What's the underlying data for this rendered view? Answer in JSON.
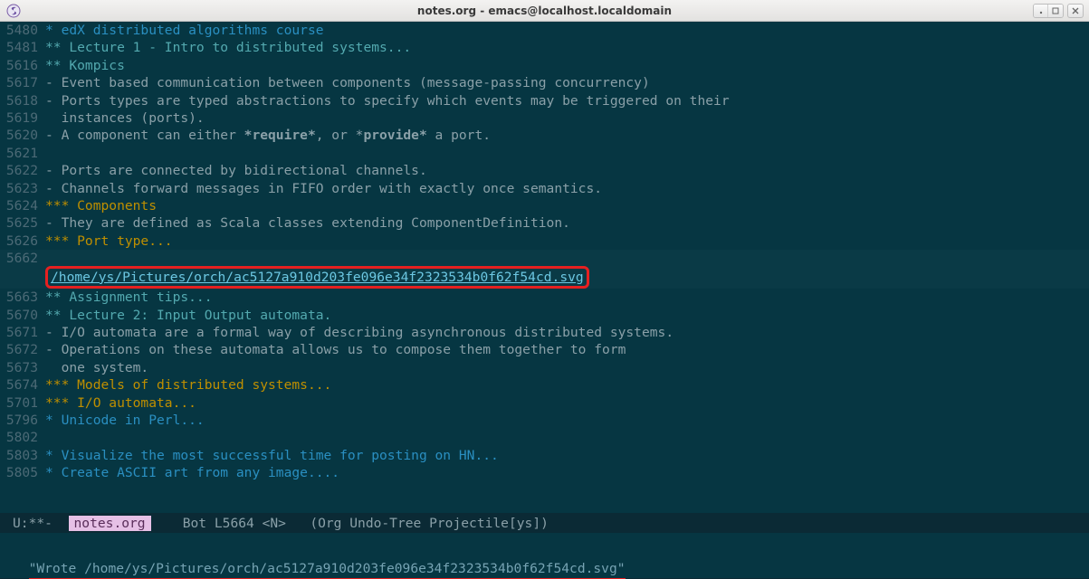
{
  "window": {
    "title": "notes.org - emacs@localhost.localdomain"
  },
  "buffer": {
    "lines": [
      {
        "n": "5480",
        "cls": "h1",
        "text": "* edX distributed algorithms course"
      },
      {
        "n": "5481",
        "cls": "h2",
        "text": "** Lecture 1 - Intro to distributed systems..."
      },
      {
        "n": "5616",
        "cls": "h2",
        "text": "** Kompics"
      },
      {
        "n": "5617",
        "cls": "txt",
        "text": "- Event based communication between components (message-passing concurrency)"
      },
      {
        "n": "5618",
        "cls": "txt",
        "text": "- Ports types are typed abstractions to specify which events may be triggered on their"
      },
      {
        "n": "5619",
        "cls": "txt",
        "text": "  instances (ports)."
      },
      {
        "n": "5620",
        "cls": "txt",
        "text": "- A component can either *require*, or *provide* a port.",
        "bold_runs": [
          [
            25,
            34
          ],
          [
            40,
            49
          ]
        ]
      },
      {
        "n": "5621",
        "cls": "txt",
        "text": ""
      },
      {
        "n": "5622",
        "cls": "txt",
        "text": "- Ports are connected by bidirectional channels."
      },
      {
        "n": "5623",
        "cls": "txt",
        "text": "- Channels forward messages in FIFO order with exactly once semantics."
      },
      {
        "n": "5624",
        "cls": "h3",
        "text": "*** Components"
      },
      {
        "n": "5625",
        "cls": "txt",
        "text": "- They are defined as Scala classes extending ComponentDefinition."
      },
      {
        "n": "5626",
        "cls": "h3",
        "text": "*** Port type..."
      },
      {
        "n": "5662",
        "cls": "txt",
        "text": "",
        "hl": true
      },
      {
        "n": "",
        "cls": "link",
        "text": "/home/ys/Pictures/orch/ac5127a910d203fe096e34f2323534b0f62f54cd.svg",
        "hl": true,
        "boxed": true
      },
      {
        "n": "",
        "cls": "txt",
        "text": "",
        "hl": true
      },
      {
        "n": "5663",
        "cls": "h2",
        "text": "** Assignment tips..."
      },
      {
        "n": "5670",
        "cls": "h2",
        "text": "** Lecture 2: Input Output automata."
      },
      {
        "n": "5671",
        "cls": "txt",
        "text": "- I/O automata are a formal way of describing asynchronous distributed systems."
      },
      {
        "n": "5672",
        "cls": "txt",
        "text": "- Operations on these automata allows us to compose them together to form"
      },
      {
        "n": "5673",
        "cls": "txt",
        "text": "  one system."
      },
      {
        "n": "5674",
        "cls": "h3",
        "text": "*** Models of distributed systems..."
      },
      {
        "n": "5701",
        "cls": "h3",
        "text": "*** I/O automata..."
      },
      {
        "n": "5796",
        "cls": "h1",
        "text": "* Unicode in Perl..."
      },
      {
        "n": "5802",
        "cls": "txt",
        "text": ""
      },
      {
        "n": "5803",
        "cls": "h1",
        "text": "* Visualize the most successful time for posting on HN..."
      },
      {
        "n": "5805",
        "cls": "h1",
        "text": "* Create ASCII art from any image...."
      }
    ]
  },
  "modeline": {
    "left": "U:**-  ",
    "buffer_name": "notes.org",
    "rest": "    Bot L5664 <N>   (Org Undo-Tree Projectile[ys])"
  },
  "echo": {
    "message": "\"Wrote /home/ys/Pictures/orch/ac5127a910d203fe096e34f2323534b0f62f54cd.svg\""
  }
}
